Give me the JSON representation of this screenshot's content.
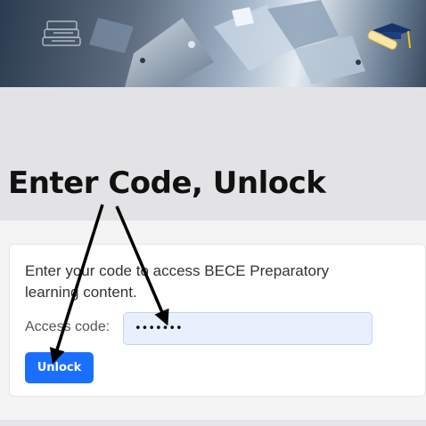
{
  "annotation": {
    "text": "Enter Code, Unlock"
  },
  "form": {
    "prompt": "Enter your code to access BECE Preparatory learning content.",
    "label": "Access code:",
    "value": "•••••••",
    "button_label": "Unlock"
  },
  "colors": {
    "button": "#1a6fff",
    "input_bg": "#e8effd",
    "gray_band": "#e3e3e6"
  },
  "icons": [
    "books-icon",
    "graduation-cap-icon",
    "diploma-icon",
    "annotation-arrow-icon"
  ]
}
